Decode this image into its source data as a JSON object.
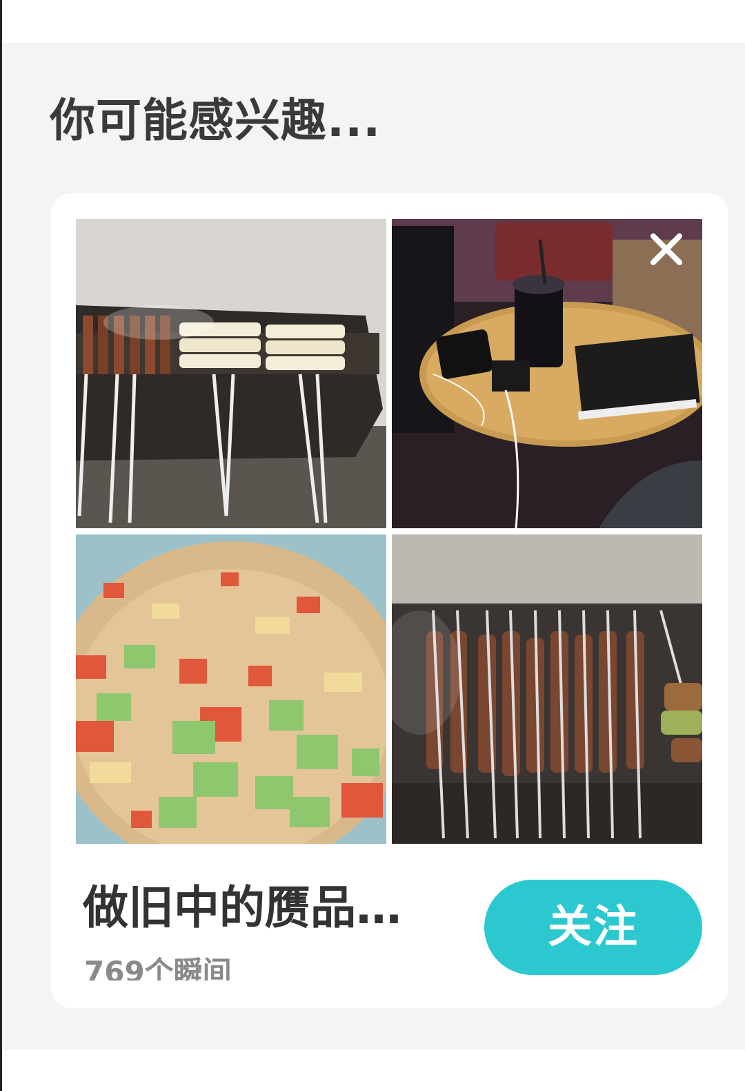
{
  "section": {
    "title": "你可能感兴趣..."
  },
  "card": {
    "photos": [
      {
        "icon": "bbq-skewers-rice-cakes-photo"
      },
      {
        "icon": "cafe-table-drink-photo"
      },
      {
        "icon": "fried-rice-photo"
      },
      {
        "icon": "lamb-skewers-grill-photo"
      }
    ],
    "close_icon": "close-icon",
    "author_name": "做旧中的赝品…",
    "moment_count": "769个瞬间",
    "follow_label": "关注"
  },
  "colors": {
    "panel_bg": "#f4f4f4",
    "card_bg": "#ffffff",
    "follow_button": "#2cc8cf",
    "title_text": "#3a3a3a",
    "sub_text": "#8a8a8a"
  }
}
